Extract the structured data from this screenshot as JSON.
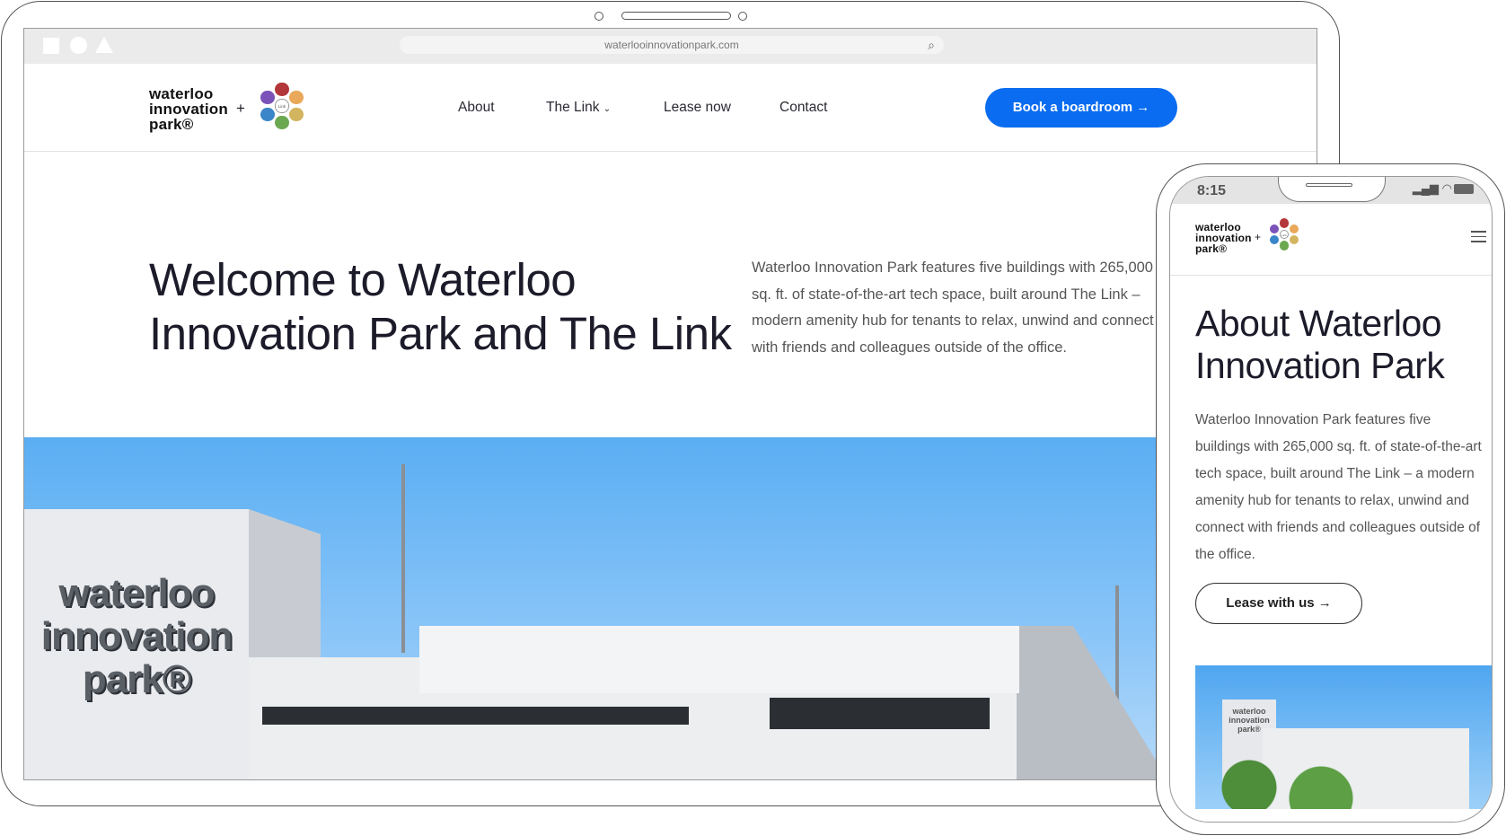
{
  "browser": {
    "url": "waterlooinnovationpark.com",
    "icons": [
      "square-icon",
      "circle-icon",
      "triangle-icon",
      "search-icon"
    ]
  },
  "logo": {
    "line1": "waterloo",
    "line2": "innovation",
    "line3": "park®",
    "plus": "+",
    "link_badge": "The Link",
    "colors": [
      "#b3363a",
      "#e9a85a",
      "#d3b45f",
      "#6ba84f",
      "#3b86c8",
      "#7a52b8"
    ]
  },
  "nav": {
    "items": [
      {
        "label": "About"
      },
      {
        "label": "The Link",
        "dropdown": true
      },
      {
        "label": "Lease now"
      },
      {
        "label": "Contact"
      }
    ],
    "cta": "Book a boardroom",
    "cta_color": "#0a6cf0"
  },
  "hero": {
    "title_line1": "Welcome to Waterloo",
    "title_line2": "Innovation Park and The Link",
    "paragraph_lines": [
      "Waterloo Innovation Park features five buildings with 265,000",
      "sq. ft. of state-of-the-art tech space, built around The Link –",
      "modern amenity hub for tenants to relax, unwind and connect",
      "with friends and colleagues outside of the office."
    ],
    "sign": [
      "waterloo",
      "innovation",
      "park®"
    ]
  },
  "mobile": {
    "time": "8:15",
    "title_line1": "About Waterloo",
    "title_line2": "Innovation Park",
    "paragraph": "Waterloo Innovation Park features five buildings with 265,000 sq. ft. of state-of-the-art tech space, built around The Link – a modern amenity hub for tenants to relax, unwind and connect with friends and colleagues outside of the office.",
    "cta": "Lease with us",
    "sign": [
      "waterloo",
      "innovation",
      "park®"
    ]
  }
}
